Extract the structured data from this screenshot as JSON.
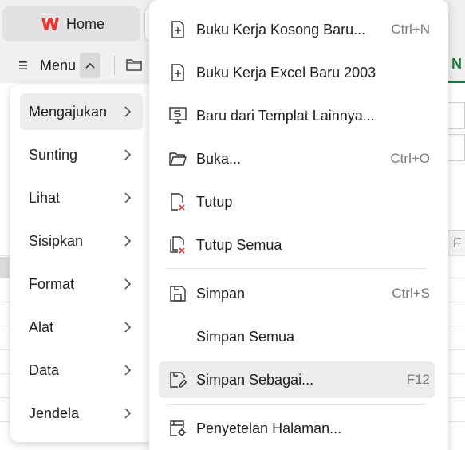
{
  "app": {
    "home_tab": "Home",
    "menu_label": "Menu",
    "column_letter": "F",
    "colors": {
      "wps_red": "#e53935",
      "green_accent": "#1e7a3c",
      "danger_x": "#e0332f"
    }
  },
  "left_menu": {
    "items": [
      {
        "label": "Mengajukan",
        "active": true
      },
      {
        "label": "Sunting"
      },
      {
        "label": "Lihat"
      },
      {
        "label": "Sisipkan"
      },
      {
        "label": "Format"
      },
      {
        "label": "Alat"
      },
      {
        "label": "Data"
      },
      {
        "label": "Jendela"
      }
    ]
  },
  "file_menu": {
    "items": [
      {
        "label": "Buku Kerja Kosong Baru...",
        "shortcut": "Ctrl+N",
        "icon": "new-doc-icon"
      },
      {
        "label": "Buku Kerja Excel Baru 2003",
        "shortcut": "",
        "icon": "new-doc-icon"
      },
      {
        "label": "Baru dari Templat Lainnya...",
        "shortcut": "",
        "icon": "template-icon"
      },
      {
        "label": "Buka...",
        "shortcut": "Ctrl+O",
        "icon": "folder-open-icon"
      },
      {
        "label": "Tutup",
        "shortcut": "",
        "icon": "close-doc-icon"
      },
      {
        "label": "Tutup Semua",
        "shortcut": "",
        "icon": "close-all-icon"
      },
      {
        "label": "Simpan",
        "shortcut": "Ctrl+S",
        "icon": "save-icon"
      },
      {
        "label": "Simpan Semua",
        "shortcut": "",
        "icon": ""
      },
      {
        "label": "Simpan Sebagai...",
        "shortcut": "F12",
        "icon": "save-as-icon",
        "active": true
      },
      {
        "label": "Penyetelan Halaman...",
        "shortcut": "",
        "icon": "page-setup-icon"
      }
    ]
  }
}
